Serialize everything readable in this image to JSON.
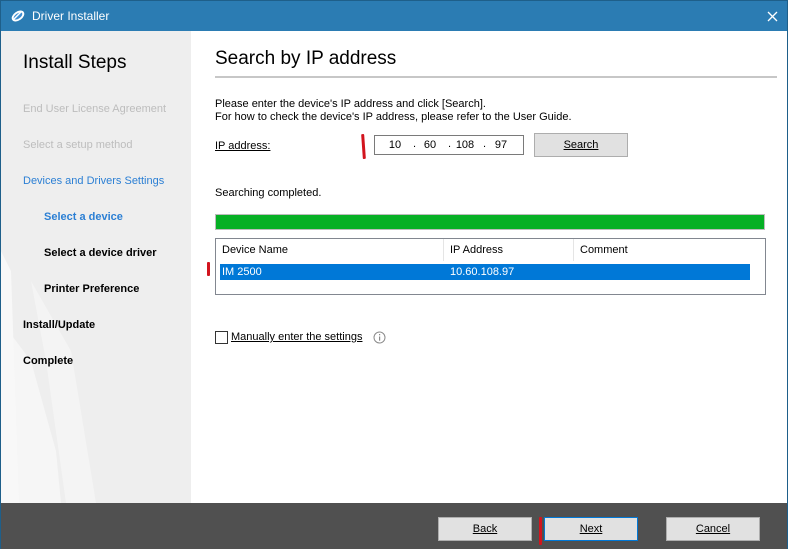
{
  "window": {
    "title": "Driver Installer"
  },
  "sidebar": {
    "title": "Install Steps",
    "steps": [
      {
        "label": "End User License Agreement",
        "state": "done"
      },
      {
        "label": "Select a setup method",
        "state": "done"
      },
      {
        "label": "Devices and Drivers Settings",
        "state": "current-group"
      },
      {
        "label": "Select a device",
        "state": "current"
      },
      {
        "label": "Select a device driver",
        "state": "pending"
      },
      {
        "label": "Printer Preference",
        "state": "pending"
      },
      {
        "label": "Install/Update",
        "state": "pending"
      },
      {
        "label": "Complete",
        "state": "pending"
      }
    ]
  },
  "main": {
    "title": "Search by IP address",
    "instruction_line1": "Please enter the device's IP address and click [Search].",
    "instruction_line2": "For how to check the device's IP address, please refer to the User Guide.",
    "ip_label": "IP address:",
    "ip_octets": [
      "10",
      "60",
      "108",
      "97"
    ],
    "search_button": "Search",
    "status": "Searching completed.",
    "progress": 1.0,
    "table": {
      "columns": [
        "Device Name",
        "IP Address",
        "Comment"
      ],
      "rows": [
        {
          "name": "IM 2500",
          "ip": "10.60.108.97",
          "comment": ""
        }
      ]
    },
    "manual_checkbox": {
      "label": "Manually enter the settings",
      "checked": false
    }
  },
  "footer": {
    "back_label": "Back",
    "next_label": "Next",
    "cancel_label": "Cancel"
  },
  "colors": {
    "titlebar": "#2b7cb3",
    "progress": "#06b025",
    "selection": "#0078d7",
    "footer": "#505050",
    "annotation_mark": "#d2141e"
  },
  "icons": [
    "app-icon",
    "close-icon",
    "info-icon"
  ]
}
